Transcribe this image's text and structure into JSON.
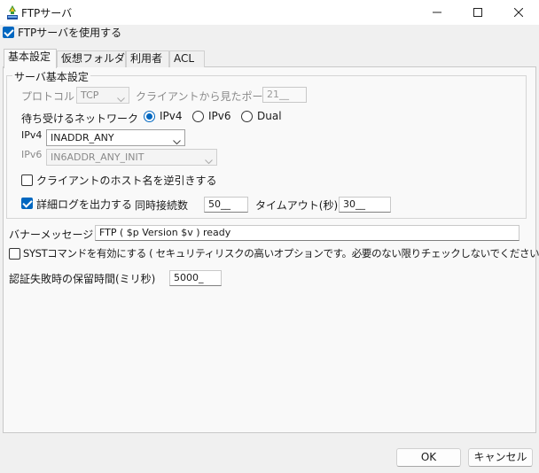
{
  "window": {
    "title": "FTPサーバ",
    "minimize_icon": "minimize-icon",
    "maximize_icon": "maximize-icon",
    "close_icon": "close-icon"
  },
  "enable_ftp": {
    "label": "FTPサーバを使用する",
    "checked": true
  },
  "tabs": [
    {
      "label": "基本設定",
      "selected": true
    },
    {
      "label": "仮想フォルダ",
      "selected": false
    },
    {
      "label": "利用者",
      "selected": false
    },
    {
      "label": "ACL",
      "selected": false
    }
  ],
  "basic": {
    "group_title": "サーバ基本設定",
    "protocol_label": "プロトコル",
    "protocol_value": "TCP",
    "client_port_label": "クライアントから見たポート",
    "client_port_value": "21__",
    "network_label": "待ち受けるネットワーク",
    "network_options": [
      "IPv4",
      "IPv6",
      "Dual"
    ],
    "network_selected": "IPv4",
    "ipv4_label": "IPv4",
    "ipv4_value": "INADDR_ANY",
    "ipv6_label": "IPv6",
    "ipv6_value": "IN6ADDR_ANY_INIT",
    "reverse_lookup_label": "クライアントのホスト名を逆引きする",
    "reverse_lookup_checked": false,
    "detail_log_label": "詳細ログを出力する",
    "detail_log_checked": true,
    "max_conn_label": "同時接続数",
    "max_conn_value": "50__",
    "timeout_label": "タイムアウト(秒)",
    "timeout_value": "30__"
  },
  "banner_label": "バナーメッセージ",
  "banner_value": "FTP ( $p Version $v ) ready",
  "syst_label": "SYSTコマンドを有効にする ( セキュリティリスクの高いオプションです。必要のない限りチェックしないでください。)",
  "syst_checked": false,
  "auth_delay_label": "認証失敗時の保留時間(ミリ秒)",
  "auth_delay_value": "5000_",
  "buttons": {
    "ok": "OK",
    "cancel": "キャンセル"
  },
  "colors": {
    "accent": "#0067c0",
    "background": "#f0f0f0",
    "panel": "#f9f9f9"
  }
}
